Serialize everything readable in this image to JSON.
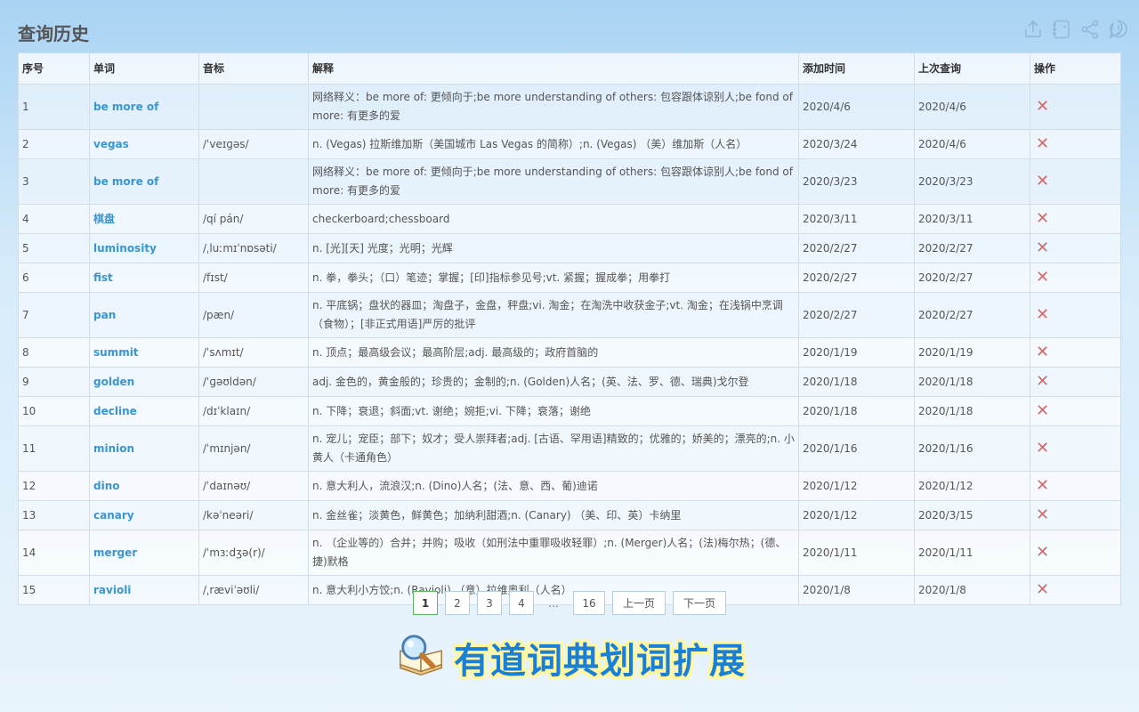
{
  "page": {
    "title": "查询历史"
  },
  "toolbar": {
    "icons": [
      "export-icon",
      "notebook-icon",
      "share-icon",
      "info-icon"
    ]
  },
  "table": {
    "headers": [
      "序号",
      "单词",
      "音标",
      "解释",
      "添加时间",
      "上次查询",
      "操作"
    ],
    "rows": [
      {
        "no": "1",
        "word": "be more of",
        "phonetic": "",
        "meaning": "网络释义：be more of: 更倾向于;be more understanding of others: 包容跟体谅别人;be fond of more: 有更多的爱",
        "added": "2020/4/6",
        "last": "2020/4/6"
      },
      {
        "no": "2",
        "word": "vegas",
        "phonetic": "/ˈveɪɡəs/",
        "meaning": "n. (Vegas) 拉斯维加斯（美国城市 Las Vegas 的简称）;n. (Vegas) （美）维加斯（人名）",
        "added": "2020/3/24",
        "last": "2020/4/6"
      },
      {
        "no": "3",
        "word": "be more of",
        "phonetic": "",
        "meaning": "网络释义：be more of: 更倾向于;be more understanding of others: 包容跟体谅别人;be fond of more: 有更多的爱",
        "added": "2020/3/23",
        "last": "2020/3/23"
      },
      {
        "no": "4",
        "word": "棋盘",
        "phonetic": "/qí pán/",
        "meaning": "checkerboard;chessboard",
        "added": "2020/3/11",
        "last": "2020/3/11"
      },
      {
        "no": "5",
        "word": "luminosity",
        "phonetic": "/ˌluːmɪˈnɒsəti/",
        "meaning": "n. [光][天] 光度；光明；光辉",
        "added": "2020/2/27",
        "last": "2020/2/27"
      },
      {
        "no": "6",
        "word": "fist",
        "phonetic": "/fɪst/",
        "meaning": "n. 拳，拳头；（口）笔迹；掌握；[印]指标参见号;vt. 紧握；握成拳；用拳打",
        "added": "2020/2/27",
        "last": "2020/2/27"
      },
      {
        "no": "7",
        "word": "pan",
        "phonetic": "/pæn/",
        "meaning": "n. 平底锅；盘状的器皿；淘盘子，金盘，秤盘;vi. 淘金；在淘洗中收获金子;vt. 淘金；在浅锅中烹调（食物）；[非正式用语]严厉的批评",
        "added": "2020/2/27",
        "last": "2020/2/27"
      },
      {
        "no": "8",
        "word": "summit",
        "phonetic": "/ˈsʌmɪt/",
        "meaning": "n. 顶点；最高级会议；最高阶层;adj. 最高级的；政府首脑的",
        "added": "2020/1/19",
        "last": "2020/1/19"
      },
      {
        "no": "9",
        "word": "golden",
        "phonetic": "/ˈɡəʊldən/",
        "meaning": "adj. 金色的，黄金般的；珍贵的；金制的;n. (Golden)人名；(英、法、罗、德、瑞典)戈尔登",
        "added": "2020/1/18",
        "last": "2020/1/18"
      },
      {
        "no": "10",
        "word": "decline",
        "phonetic": "/dɪˈklaɪn/",
        "meaning": "n. 下降；衰退；斜面;vt. 谢绝；婉拒;vi. 下降；衰落；谢绝",
        "added": "2020/1/18",
        "last": "2020/1/18"
      },
      {
        "no": "11",
        "word": "minion",
        "phonetic": "/ˈmɪnjən/",
        "meaning": "n. 宠儿；宠臣；部下；奴才；受人崇拜者;adj. [古语、罕用语]精致的；优雅的；娇美的；漂亮的;n. 小黄人（卡通角色）",
        "added": "2020/1/16",
        "last": "2020/1/16"
      },
      {
        "no": "12",
        "word": "dino",
        "phonetic": "/ˈdaɪnəʊ/",
        "meaning": "n. 意大利人，流浪汉;n. (Dino)人名；(法、意、西、葡)迪诺",
        "added": "2020/1/12",
        "last": "2020/1/12"
      },
      {
        "no": "13",
        "word": "canary",
        "phonetic": "/kəˈneəri/",
        "meaning": "n. 金丝雀；淡黄色，鲜黄色；加纳利甜酒;n. (Canary) （美、印、英）卡纳里",
        "added": "2020/1/12",
        "last": "2020/3/15"
      },
      {
        "no": "14",
        "word": "merger",
        "phonetic": "/ˈmɜːdʒə(r)/",
        "meaning": "n. （企业等的）合并；并购；吸收（如刑法中重罪吸收轻罪）;n. (Merger)人名；(法)梅尔热；(德、捷)默格",
        "added": "2020/1/11",
        "last": "2020/1/11"
      },
      {
        "no": "15",
        "word": "ravioli",
        "phonetic": "/ˌræviˈəʊli/",
        "meaning": "n. 意大利小方饺;n. (Ravioli) （意）拉维奥利（人名）",
        "added": "2020/1/8",
        "last": "2020/1/8"
      }
    ],
    "delete_glyph": "✕"
  },
  "pagination": {
    "pages": [
      "1",
      "2",
      "3",
      "4"
    ],
    "ellipsis": "...",
    "last_page": "16",
    "prev_label": "上一页",
    "next_label": "下一页",
    "active": "1"
  },
  "brand": {
    "text": "有道词典划词扩展"
  },
  "colors": {
    "link": "#3a95d4",
    "delete": "#d06c6c",
    "active_page_border": "#5cb85c",
    "brand_text": "#1a7fd6"
  }
}
